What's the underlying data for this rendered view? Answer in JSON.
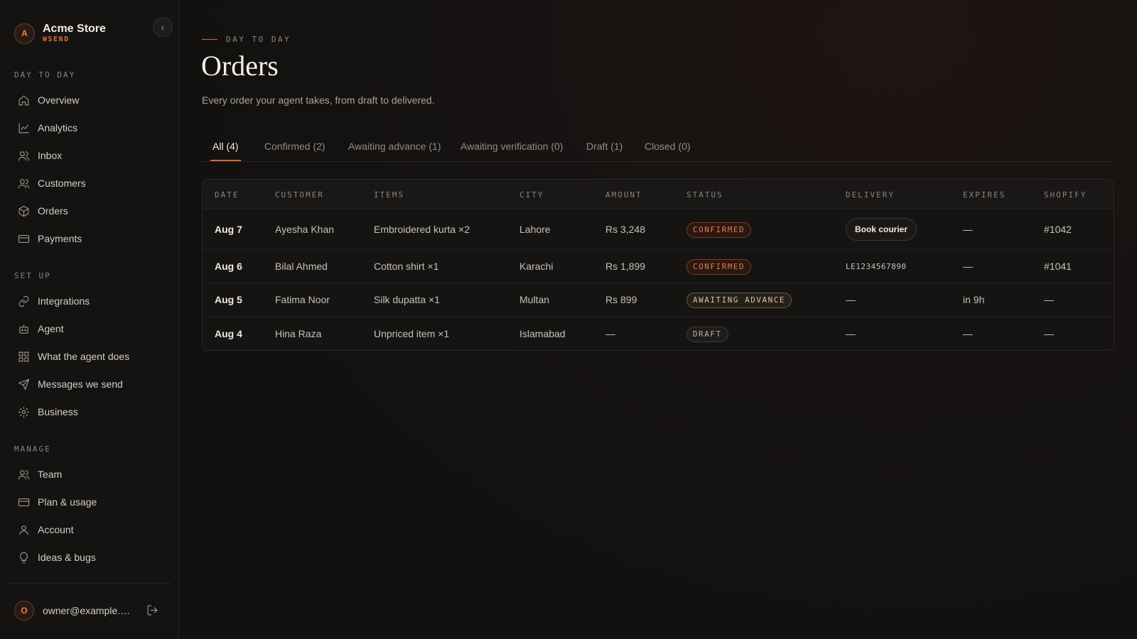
{
  "brand": {
    "avatar": "A",
    "name": "Acme Store",
    "sub": "WSEND"
  },
  "sidebar": {
    "sections": [
      {
        "title": "DAY TO DAY",
        "items": [
          {
            "label": "Overview",
            "icon": "home-icon"
          },
          {
            "label": "Analytics",
            "icon": "chart-icon"
          },
          {
            "label": "Inbox",
            "icon": "users-icon"
          },
          {
            "label": "Customers",
            "icon": "users-icon"
          },
          {
            "label": "Orders",
            "icon": "box-icon"
          },
          {
            "label": "Payments",
            "icon": "card-icon"
          }
        ]
      },
      {
        "title": "SET UP",
        "items": [
          {
            "label": "Integrations",
            "icon": "link-icon"
          },
          {
            "label": "Agent",
            "icon": "bot-icon"
          },
          {
            "label": "What the agent does",
            "icon": "grid-icon"
          },
          {
            "label": "Messages we send",
            "icon": "send-icon"
          },
          {
            "label": "Business",
            "icon": "gear-icon"
          }
        ]
      },
      {
        "title": "MANAGE",
        "items": [
          {
            "label": "Team",
            "icon": "users-icon"
          },
          {
            "label": "Plan & usage",
            "icon": "card-icon"
          },
          {
            "label": "Account",
            "icon": "user-icon"
          },
          {
            "label": "Ideas & bugs",
            "icon": "bulb-icon"
          }
        ]
      }
    ],
    "user": {
      "avatar": "O",
      "email": "owner@example.com"
    }
  },
  "page": {
    "eyebrow": "DAY TO DAY",
    "title": "Orders",
    "subtitle": "Every order your agent takes, from draft to delivered."
  },
  "tabs": [
    {
      "label": "All (4)",
      "active": true
    },
    {
      "label": "Confirmed (2)"
    },
    {
      "label": "Awaiting advance (1)"
    },
    {
      "label": "Awaiting verification (0)"
    },
    {
      "label": "Draft (1)"
    },
    {
      "label": "Closed (0)"
    }
  ],
  "table": {
    "headers": [
      "DATE",
      "CUSTOMER",
      "ITEMS",
      "CITY",
      "AMOUNT",
      "STATUS",
      "DELIVERY",
      "EXPIRES",
      "SHOPIFY"
    ],
    "rows": [
      {
        "date": "Aug 7",
        "customer": "Ayesha Khan",
        "items": "Embroidered kurta ×2",
        "city": "Lahore",
        "amount": "Rs 3,248",
        "status": "CONFIRMED",
        "delivery": "Book courier",
        "expires": "—",
        "shopify": "#1042"
      },
      {
        "date": "Aug 6",
        "customer": "Bilal Ahmed",
        "items": "Cotton shirt ×1",
        "city": "Karachi",
        "amount": "Rs 1,899",
        "status": "CONFIRMED",
        "delivery": "LE1234567890",
        "expires": "—",
        "shopify": "#1041"
      },
      {
        "date": "Aug 5",
        "customer": "Fatima Noor",
        "items": "Silk dupatta ×1",
        "city": "Multan",
        "amount": "Rs 899",
        "status": "AWAITING ADVANCE",
        "delivery": "—",
        "expires": "in 9h",
        "shopify": "—"
      },
      {
        "date": "Aug 4",
        "customer": "Hina Raza",
        "items": "Unpriced item ×1",
        "city": "Islamabad",
        "amount": "—",
        "status": "DRAFT",
        "delivery": "—",
        "expires": "—",
        "shopify": "—"
      }
    ]
  },
  "colors": {
    "accent": "#d9653a",
    "background": "#121110",
    "sidebar": "#141312"
  }
}
